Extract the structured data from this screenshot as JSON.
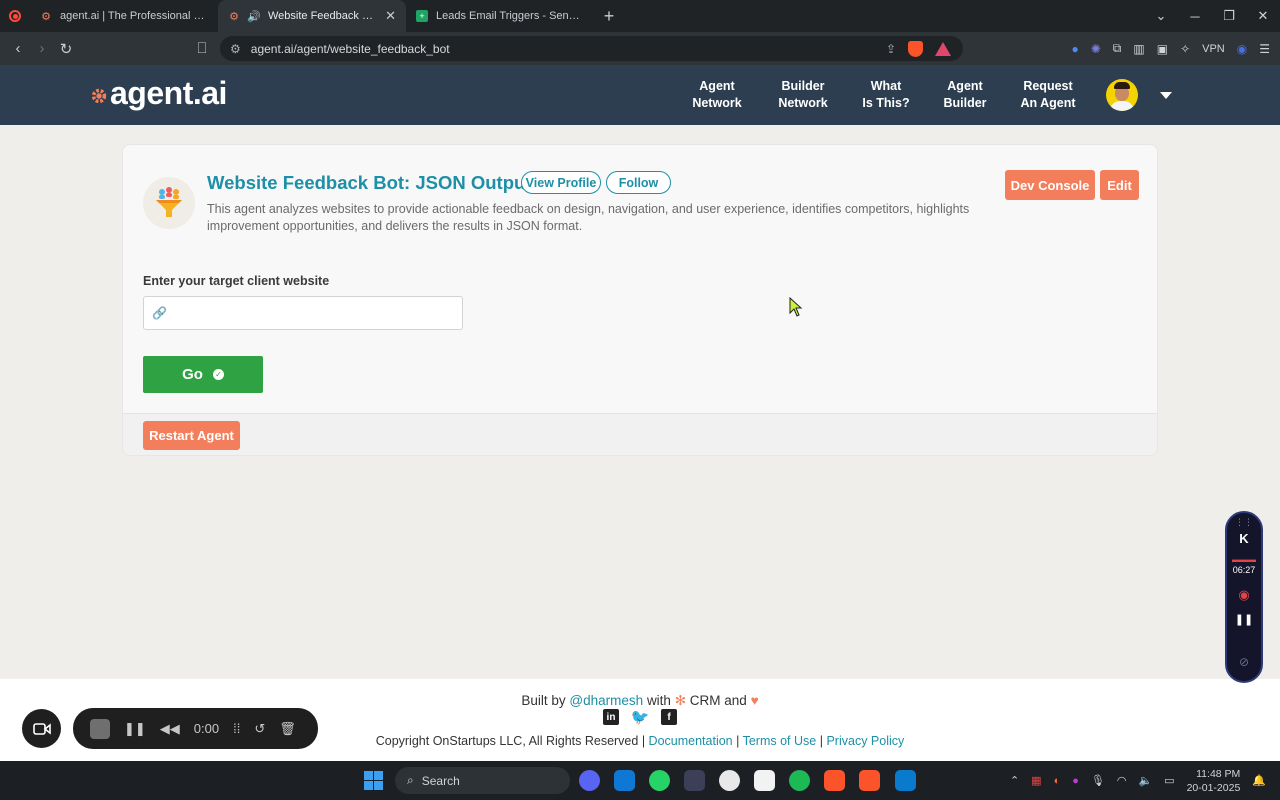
{
  "browser": {
    "tabs": [
      {
        "title": "agent.ai | The Professional Network",
        "active": false
      },
      {
        "title": "Website Feedback Bot: JSON",
        "active": true
      },
      {
        "title": "Leads Email Triggers - Sending Sheet",
        "active": false
      }
    ],
    "url": "agent.ai/agent/website_feedback_bot",
    "brave_badge": "8",
    "alert_badge": "1",
    "ext_badge": "6",
    "vpn_label": "VPN"
  },
  "site": {
    "logo_text": "agent.ai",
    "nav": [
      {
        "line1": "Agent",
        "line2": "Network"
      },
      {
        "line1": "Builder",
        "line2": "Network"
      },
      {
        "line1": "What",
        "line2": "Is This?"
      },
      {
        "line1": "Agent",
        "line2": "Builder"
      },
      {
        "line1": "Request",
        "line2": "An Agent"
      }
    ]
  },
  "agent": {
    "title": "Website Feedback Bot: JSON Output",
    "view_profile": "View Profile",
    "follow": "Follow",
    "description": "This agent analyzes websites to provide actionable feedback on design, navigation, and user experience, identifies competitors, highlights improvement opportunities, and delivers the results in JSON format.",
    "dev_console": "Dev Console",
    "edit": "Edit",
    "input_label": "Enter your target client website",
    "input_value": "",
    "go_label": "Go",
    "restart_label": "Restart Agent"
  },
  "footer": {
    "built_by_prefix": "Built by",
    "built_by_handle": "@dharmesh",
    "built_with": "with",
    "crm": "CRM and",
    "copyright": "Copyright OnStartups LLC, All Rights Reserved |",
    "documentation": "Documentation",
    "sep": "|",
    "terms": "Terms of Use",
    "privacy": "Privacy Policy"
  },
  "recorder": {
    "time": "0:00",
    "side_time": "06:27"
  },
  "taskbar": {
    "search_placeholder": "Search",
    "time": "11:48 PM",
    "date": "20-01-2025"
  },
  "colors": {
    "header_bg": "#2c3e50",
    "accent_teal": "#1d8fa6",
    "accent_orange": "#f37e5b",
    "go_green": "#2fa344"
  }
}
